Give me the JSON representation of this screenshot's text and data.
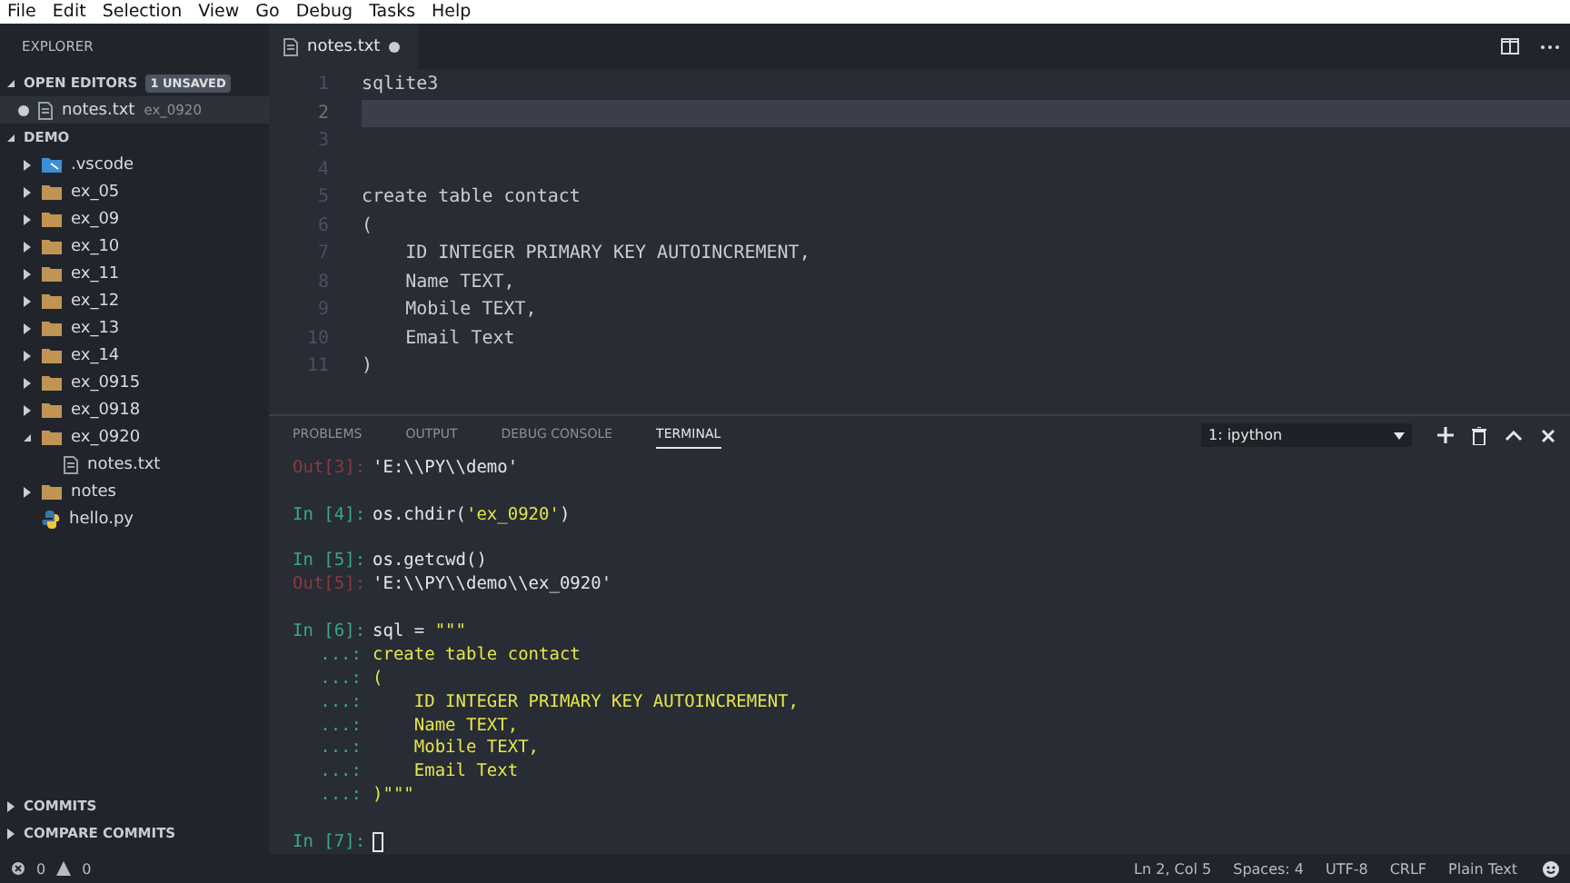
{
  "menu": [
    "File",
    "Edit",
    "Selection",
    "View",
    "Go",
    "Debug",
    "Tasks",
    "Help"
  ],
  "sidebar": {
    "title": "EXPLORER",
    "open_editors": {
      "label": "OPEN EDITORS",
      "expanded": true,
      "badge": "1 UNSAVED",
      "items": [
        {
          "name": "notes.txt",
          "folder": "ex_0920",
          "unsaved": true
        }
      ]
    },
    "workspace": {
      "label": "DEMO",
      "expanded": true,
      "items": [
        {
          "kind": "vscode",
          "name": ".vscode",
          "expanded": false
        },
        {
          "kind": "folder",
          "name": "ex_05",
          "expanded": false
        },
        {
          "kind": "folder",
          "name": "ex_09",
          "expanded": false
        },
        {
          "kind": "folder",
          "name": "ex_10",
          "expanded": false
        },
        {
          "kind": "folder",
          "name": "ex_11",
          "expanded": false
        },
        {
          "kind": "folder",
          "name": "ex_12",
          "expanded": false
        },
        {
          "kind": "folder",
          "name": "ex_13",
          "expanded": false
        },
        {
          "kind": "folder",
          "name": "ex_14",
          "expanded": false
        },
        {
          "kind": "folder",
          "name": "ex_0915",
          "expanded": false
        },
        {
          "kind": "folder",
          "name": "ex_0918",
          "expanded": false
        },
        {
          "kind": "folder",
          "name": "ex_0920",
          "expanded": true,
          "children": [
            {
              "kind": "file",
              "name": "notes.txt"
            }
          ]
        },
        {
          "kind": "folder",
          "name": "notes",
          "expanded": false
        },
        {
          "kind": "python",
          "name": "hello.py"
        }
      ]
    },
    "bottom_sections": [
      {
        "label": "COMMITS",
        "expanded": false
      },
      {
        "label": "COMPARE COMMITS",
        "expanded": false
      }
    ]
  },
  "editor": {
    "tab": {
      "name": "notes.txt",
      "unsaved": true
    },
    "lines": [
      {
        "number": "1",
        "text": "sqlite3",
        "current": false
      },
      {
        "number": "2",
        "current": true
      },
      {
        "number": "3",
        "current": false
      },
      {
        "number": "4",
        "current": false
      },
      {
        "number": "5",
        "text": "create table contact",
        "current": false
      },
      {
        "number": "6",
        "text": "(",
        "current": false
      },
      {
        "number": "7",
        "text": "    ID INTEGER PRIMARY KEY AUTOINCREMENT,",
        "current": false
      },
      {
        "number": "8",
        "text": "    Name TEXT,",
        "current": false
      },
      {
        "number": "9",
        "text": "    Mobile TEXT,",
        "current": false
      },
      {
        "number": "10",
        "text": "    Email Text",
        "current": false
      },
      {
        "number": "11",
        "text": ")",
        "current": false
      }
    ]
  },
  "panel": {
    "tabs": [
      {
        "label": "PROBLEMS",
        "selected": false
      },
      {
        "label": "OUTPUT",
        "selected": false
      },
      {
        "label": "DEBUG CONSOLE",
        "selected": false
      },
      {
        "label": "TERMINAL",
        "selected": true
      }
    ],
    "terminal_select": "1: ipython",
    "blocks": [
      [
        {
          "kind": "out",
          "prompt": "Out[3]:",
          "parts": [
            {
              "kind": "plain",
              "text": "'E:\\\\PY\\\\demo'"
            }
          ]
        }
      ],
      [
        {
          "kind": "in",
          "prompt": "In [4]:",
          "parts": [
            {
              "kind": "plain",
              "text": "os.chdir("
            },
            {
              "kind": "string",
              "text": "'ex_0920'"
            },
            {
              "kind": "plain",
              "text": ")"
            }
          ]
        }
      ],
      [
        {
          "kind": "in",
          "prompt": "In [5]:",
          "parts": [
            {
              "kind": "plain",
              "text": "os.getcwd()"
            }
          ]
        },
        {
          "kind": "out",
          "prompt": "Out[5]:",
          "parts": [
            {
              "kind": "plain",
              "text": "'E:\\\\PY\\\\demo\\\\ex_0920'"
            }
          ]
        }
      ],
      [
        {
          "kind": "in",
          "prompt": "In [6]:",
          "parts": [
            {
              "kind": "plain",
              "text": "sql = "
            },
            {
              "kind": "string",
              "text": "\"\"\""
            }
          ]
        },
        {
          "kind": "cont",
          "prompt": "...:",
          "parts": [
            {
              "kind": "string",
              "text": "create table contact"
            }
          ]
        },
        {
          "kind": "cont",
          "prompt": "...:",
          "parts": [
            {
              "kind": "string",
              "text": "("
            }
          ]
        },
        {
          "kind": "cont",
          "prompt": "...:",
          "parts": [
            {
              "kind": "string",
              "text": "    ID INTEGER PRIMARY KEY AUTOINCREMENT,"
            }
          ]
        },
        {
          "kind": "cont",
          "prompt": "...:",
          "parts": [
            {
              "kind": "string",
              "text": "    Name TEXT,"
            }
          ]
        },
        {
          "kind": "cont",
          "prompt": "...:",
          "parts": [
            {
              "kind": "string",
              "text": "    Mobile TEXT,"
            }
          ]
        },
        {
          "kind": "cont",
          "prompt": "...:",
          "parts": [
            {
              "kind": "string",
              "text": "    Email Text"
            }
          ]
        },
        {
          "kind": "cont",
          "prompt": "...:",
          "parts": [
            {
              "kind": "string",
              "text": ")\"\"\""
            }
          ]
        }
      ],
      [
        {
          "kind": "in",
          "prompt": "In [7]:",
          "cursor": true
        }
      ]
    ]
  },
  "status_bar": {
    "errors": "0",
    "warnings": "0",
    "items": [
      "Ln 2, Col 5",
      "Spaces: 4",
      "UTF-8",
      "CRLF",
      "Plain Text"
    ]
  }
}
